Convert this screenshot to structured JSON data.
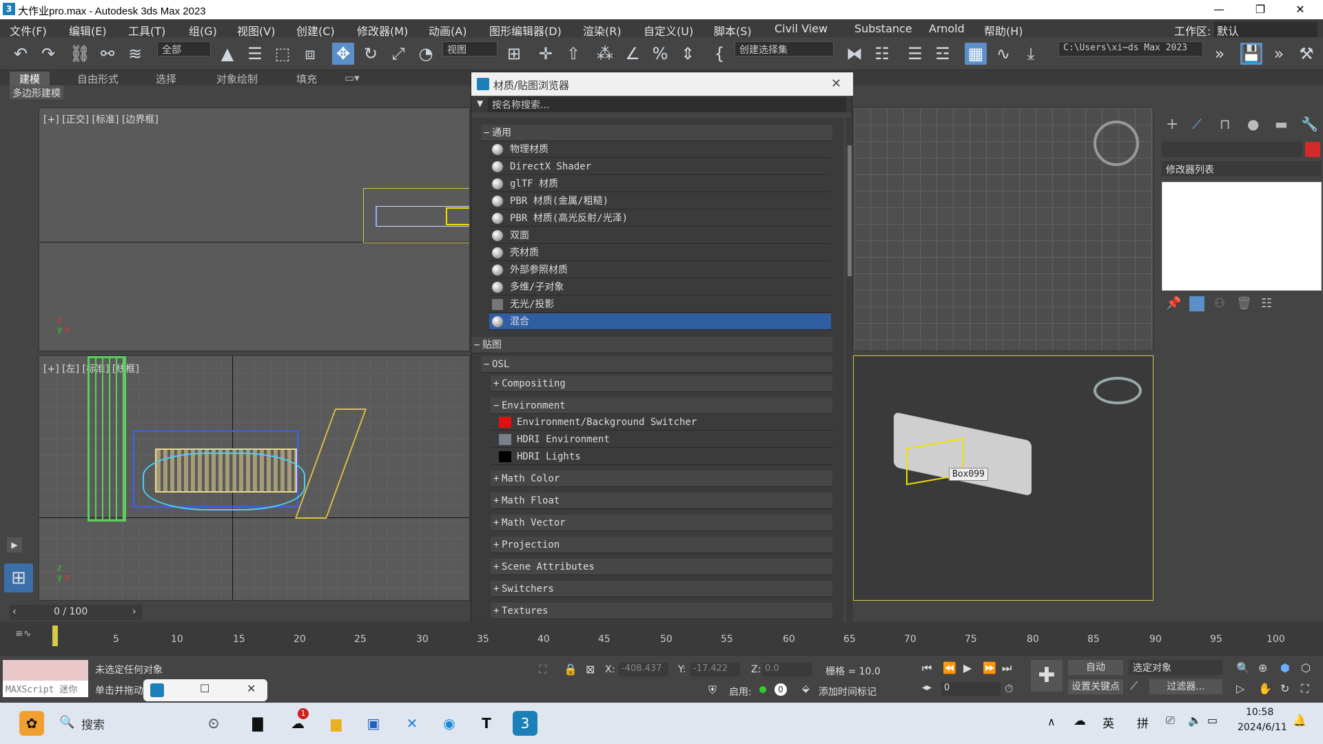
{
  "window": {
    "title": "大作业pro.max - Autodesk 3ds Max 2023",
    "logo": "3"
  },
  "menu": {
    "items": [
      "文件(F)",
      "编辑(E)",
      "工具(T)",
      "组(G)",
      "视图(V)",
      "创建(C)",
      "修改器(M)",
      "动画(A)",
      "图形编辑器(D)",
      "渲染(R)",
      "自定义(U)",
      "脚本(S)",
      "Civil View",
      "Substance",
      "Arnold",
      "帮助(H)"
    ],
    "workspace_label": "工作区:",
    "workspace_value": "默认"
  },
  "toolbar": {
    "filter": "全部",
    "refcoord": "视图",
    "selset": "创建选择集",
    "path": "C:\\Users\\xi⋯ds Max 2023"
  },
  "ribbon": {
    "tabs": [
      "建模",
      "自由形式",
      "选择",
      "对象绘制",
      "填充"
    ],
    "sub": "多边形建模"
  },
  "viewports": {
    "top_label": "[+] [正交] [标准] [边界框]",
    "left_label": "[+] [左] [标准] [线框]",
    "object_label": "Box099"
  },
  "dialog": {
    "title": "材质/贴图浏览器",
    "search": "按名称搜索...",
    "group_general": "通用",
    "materials": [
      "物理材质",
      "DirectX Shader",
      "glTF 材质",
      "PBR 材质(金属/粗糙)",
      "PBR 材质(高光反射/光泽)",
      "双面",
      "壳材质",
      "外部参照材质",
      "多维/子对象",
      "无光/投影",
      "混合"
    ],
    "group_maps": "贴图",
    "group_osl": "OSL",
    "subgroups": [
      "Compositing",
      "Environment",
      "Math Color",
      "Math Float",
      "Math Vector",
      "Projection",
      "Scene Attributes",
      "Switchers",
      "Textures"
    ],
    "env_maps": [
      "Environment/Background Switcher",
      "HDRI Environment",
      "HDRI Lights"
    ],
    "swatch_colors": [
      "#e01010",
      "#7a7f8a",
      "#000000"
    ]
  },
  "command_panel": {
    "modifier_list": "修改器列表"
  },
  "timeline": {
    "frame": "0 / 100",
    "ticks": [
      "5",
      "10",
      "15",
      "20",
      "25",
      "30",
      "35",
      "40",
      "45",
      "50",
      "55",
      "60",
      "65",
      "70",
      "75",
      "80",
      "85",
      "90",
      "95",
      "100"
    ]
  },
  "status": {
    "script_label": "MAXScript 迷你",
    "msg1": "未选定任何对象",
    "msg2": "单击并拖动",
    "x_label": "X:",
    "x_val": "-408.437",
    "y_label": "Y:",
    "y_val": "-17.422",
    "z_label": "Z:",
    "z_val": "0.0",
    "grid": "栅格 = 10.0",
    "enable": "启用:",
    "enable_val": "0",
    "add_time_tag": "添加时间标记",
    "auto": "自动",
    "selected": "选定对象",
    "set_key": "设置关键点",
    "filters": "过滤器...",
    "frame_val": "0"
  },
  "taskbar": {
    "search": "搜索",
    "lang": "英",
    "ime": "拼",
    "time": "10:58",
    "date": "2024/6/11",
    "badge": "1"
  }
}
